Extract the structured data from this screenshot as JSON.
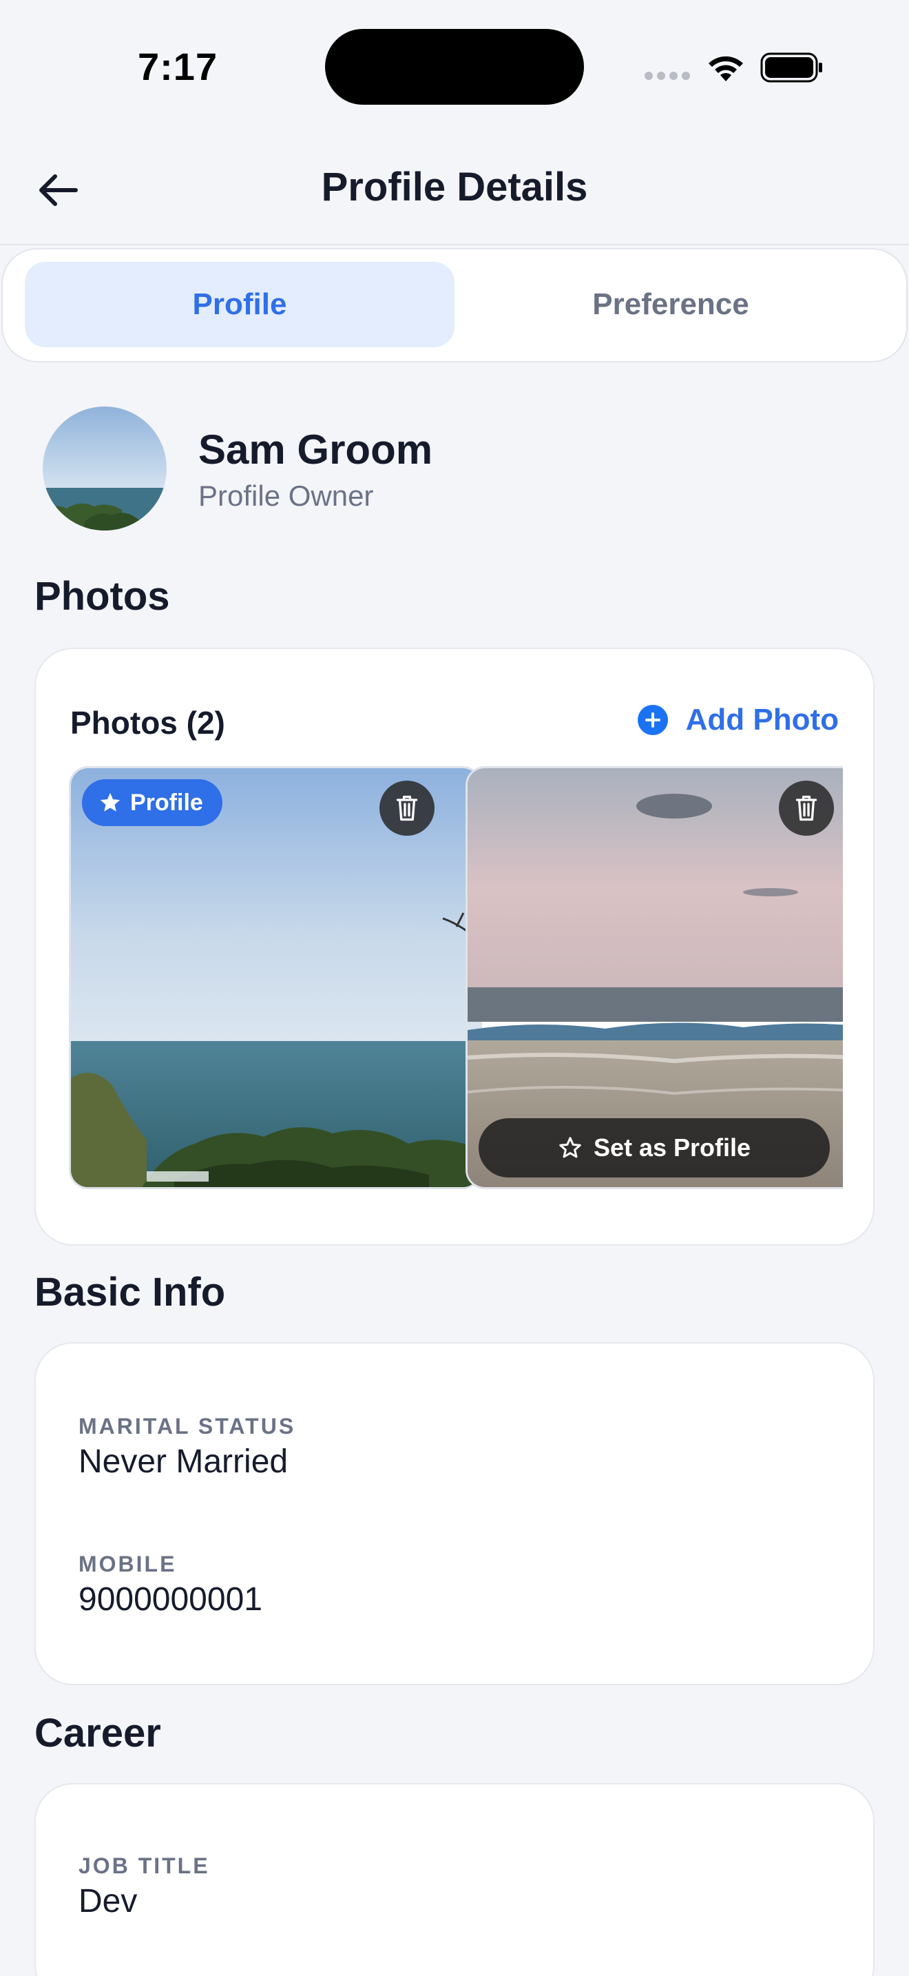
{
  "status_bar": {
    "time": "7:17"
  },
  "header": {
    "title": "Profile Details"
  },
  "tabs": [
    {
      "label": "Profile",
      "active": true
    },
    {
      "label": "Preference",
      "active": false
    }
  ],
  "profile": {
    "name": "Sam Groom",
    "role": "Profile Owner"
  },
  "photos_section": {
    "heading": "Photos",
    "count_label": "Photos (2)",
    "add_label": "Add Photo",
    "items": [
      {
        "badge": "Profile",
        "is_profile": true
      },
      {
        "action": "Set as Profile",
        "is_profile": false
      }
    ]
  },
  "basic_info": {
    "heading": "Basic Info",
    "fields": [
      {
        "label": "MARITAL STATUS",
        "value": "Never Married"
      },
      {
        "label": "MOBILE",
        "value": "9000000001"
      }
    ]
  },
  "career": {
    "heading": "Career",
    "fields": [
      {
        "label": "JOB TITLE",
        "value": "Dev"
      }
    ]
  },
  "colors": {
    "accent": "#2f6fe7",
    "background": "#f4f5f9",
    "active_tab_bg": "#e4edfd",
    "muted_text": "#6b7286"
  }
}
